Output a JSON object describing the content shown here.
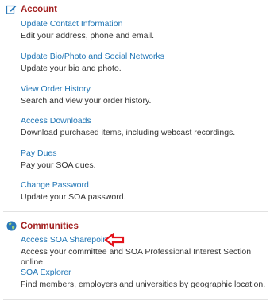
{
  "colors": {
    "section_title": "#a21f1f",
    "link": "#1f75b5",
    "annotation_arrow": "#e3141b"
  },
  "account": {
    "icon": "edit-icon",
    "title": "Account",
    "items": [
      {
        "link": "Update Contact Information",
        "desc": "Edit your address, phone and email."
      },
      {
        "link": "Update Bio/Photo and Social Networks",
        "desc": "Update your bio and photo."
      },
      {
        "link": "View Order History",
        "desc": "Search and view your order history."
      },
      {
        "link": "Access Downloads",
        "desc": "Download purchased items, including webcast recordings."
      },
      {
        "link": "Pay Dues",
        "desc": "Pay your SOA dues."
      },
      {
        "link": "Change Password",
        "desc": "Update your SOA password."
      }
    ]
  },
  "communities": {
    "icon": "globe-icon",
    "title": "Communities",
    "items": [
      {
        "link": "Access SOA Sharepoint",
        "desc": "Access your committee and SOA Professional Interest Section online."
      },
      {
        "link": "SOA Explorer",
        "desc": "Find members, employers and universities by geographic location."
      }
    ]
  },
  "annotation": {
    "icon": "left-arrow-icon"
  }
}
